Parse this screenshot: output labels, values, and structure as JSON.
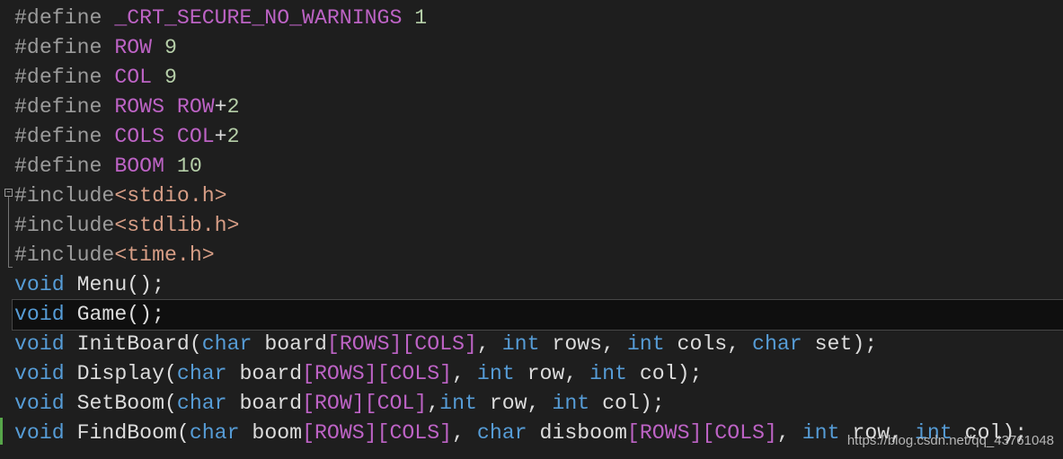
{
  "code_lines": [
    [
      [
        "pp",
        "#define "
      ],
      [
        "mac",
        "_CRT_SECURE_NO_WARNINGS"
      ],
      [
        "txt",
        " "
      ],
      [
        "num",
        "1"
      ]
    ],
    [
      [
        "pp",
        "#define "
      ],
      [
        "mac",
        "ROW"
      ],
      [
        "txt",
        " "
      ],
      [
        "num",
        "9"
      ]
    ],
    [
      [
        "pp",
        "#define "
      ],
      [
        "mac",
        "COL"
      ],
      [
        "txt",
        " "
      ],
      [
        "num",
        "9"
      ]
    ],
    [
      [
        "pp",
        "#define "
      ],
      [
        "mac",
        "ROWS"
      ],
      [
        "txt",
        " "
      ],
      [
        "mac",
        "ROW"
      ],
      [
        "txt",
        "+"
      ],
      [
        "num",
        "2"
      ]
    ],
    [
      [
        "pp",
        "#define "
      ],
      [
        "mac",
        "COLS"
      ],
      [
        "txt",
        " "
      ],
      [
        "mac",
        "COL"
      ],
      [
        "txt",
        "+"
      ],
      [
        "num",
        "2"
      ]
    ],
    [
      [
        "pp",
        "#define "
      ],
      [
        "mac",
        "BOOM"
      ],
      [
        "txt",
        " "
      ],
      [
        "num",
        "10"
      ]
    ],
    [
      [
        "pp",
        "#include"
      ],
      [
        "str",
        "<stdio.h>"
      ]
    ],
    [
      [
        "pp",
        "#include"
      ],
      [
        "str",
        "<stdlib.h>"
      ]
    ],
    [
      [
        "pp",
        "#include"
      ],
      [
        "str",
        "<time.h>"
      ]
    ],
    [
      [
        "kw",
        "void"
      ],
      [
        "txt",
        " Menu();"
      ]
    ],
    [
      [
        "kw",
        "void"
      ],
      [
        "txt",
        " Game();"
      ]
    ],
    [
      [
        "kw",
        "void"
      ],
      [
        "txt",
        " InitBoard("
      ],
      [
        "kw",
        "char"
      ],
      [
        "txt",
        " board"
      ],
      [
        "mac",
        "[ROWS][COLS]"
      ],
      [
        "txt",
        ", "
      ],
      [
        "kw",
        "int"
      ],
      [
        "txt",
        " rows, "
      ],
      [
        "kw",
        "int"
      ],
      [
        "txt",
        " cols, "
      ],
      [
        "kw",
        "char"
      ],
      [
        "txt",
        " set);"
      ]
    ],
    [
      [
        "kw",
        "void"
      ],
      [
        "txt",
        " Display("
      ],
      [
        "kw",
        "char"
      ],
      [
        "txt",
        " board"
      ],
      [
        "mac",
        "[ROWS][COLS]"
      ],
      [
        "txt",
        ", "
      ],
      [
        "kw",
        "int"
      ],
      [
        "txt",
        " row, "
      ],
      [
        "kw",
        "int"
      ],
      [
        "txt",
        " col);"
      ]
    ],
    [
      [
        "kw",
        "void"
      ],
      [
        "txt",
        " SetBoom("
      ],
      [
        "kw",
        "char"
      ],
      [
        "txt",
        " board"
      ],
      [
        "mac",
        "[ROW][COL]"
      ],
      [
        "txt",
        ","
      ],
      [
        "kw",
        "int"
      ],
      [
        "txt",
        " row, "
      ],
      [
        "kw",
        "int"
      ],
      [
        "txt",
        " col);"
      ]
    ],
    [
      [
        "kw",
        "void"
      ],
      [
        "txt",
        " FindBoom("
      ],
      [
        "kw",
        "char"
      ],
      [
        "txt",
        " boom"
      ],
      [
        "mac",
        "[ROWS][COLS]"
      ],
      [
        "txt",
        ", "
      ],
      [
        "kw",
        "char"
      ],
      [
        "txt",
        " disboom"
      ],
      [
        "mac",
        "[ROWS][COLS]"
      ],
      [
        "txt",
        ", "
      ],
      [
        "kw",
        "int"
      ],
      [
        "txt",
        " row, "
      ],
      [
        "kw",
        "int"
      ],
      [
        "txt",
        " col);"
      ]
    ]
  ],
  "current_line": 10,
  "colors": {
    "background": "#1e1e1e",
    "preprocessor": "#9b9b9b",
    "macro": "#bd63c5",
    "number": "#b5cea8",
    "keyword": "#569cd6",
    "string": "#d69d85",
    "text": "#dcdcdc"
  },
  "watermark": "https://blog.csdn.net/qq_43761048"
}
